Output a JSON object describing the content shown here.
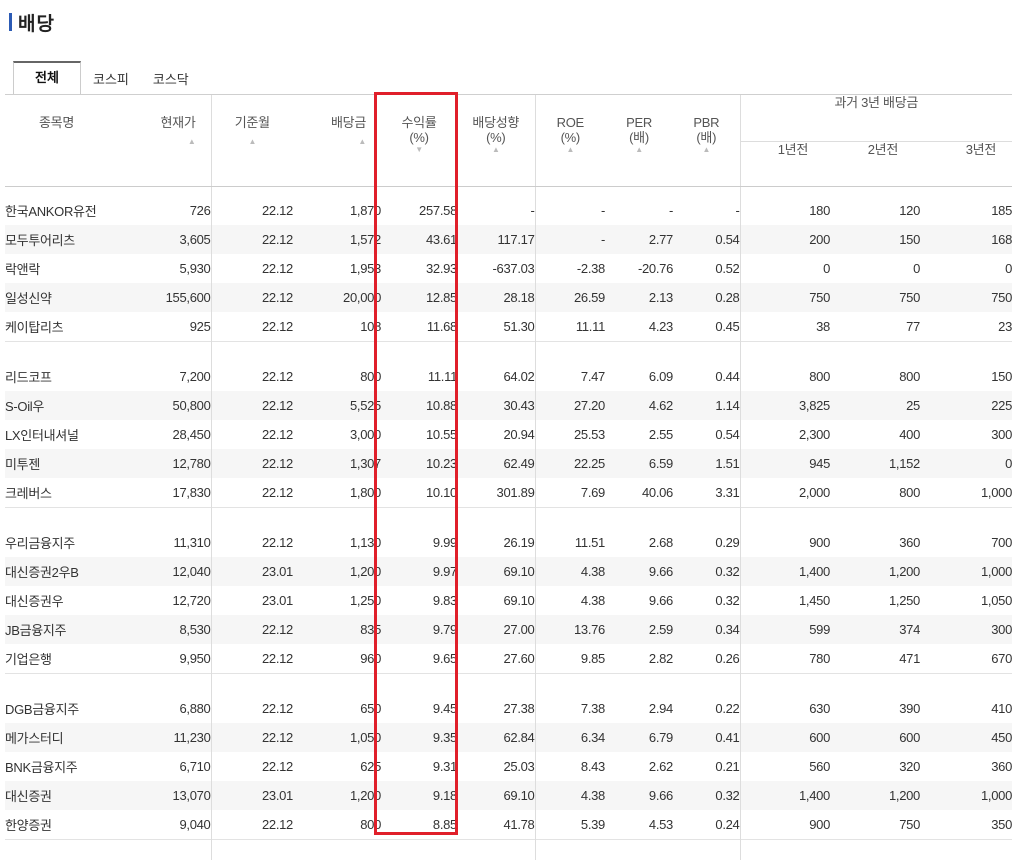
{
  "page_title": "배당",
  "tabs": [
    {
      "label": "전체",
      "active": true
    },
    {
      "label": "코스피",
      "active": false
    },
    {
      "label": "코스닥",
      "active": false
    }
  ],
  "columns": {
    "name": "종목명",
    "price": "현재가",
    "base_month": "기준월",
    "dividend": "배당금",
    "yield_line1": "수익률",
    "yield_line2": "(%)",
    "payout_line1": "배당성향",
    "payout_line2": "(%)",
    "roe_line1": "ROE",
    "roe_line2": "(%)",
    "per_line1": "PER",
    "per_line2": "(배)",
    "pbr_line1": "PBR",
    "pbr_line2": "(배)",
    "past_group": "과거 3년 배당금",
    "y1": "1년전",
    "y2": "2년전",
    "y3": "3년전"
  },
  "sort_icon": "triangle-down-icon",
  "accent_color": "#e01f2a",
  "groups": [
    [
      [
        "한국ANKOR유전",
        "726",
        "22.12",
        "1,870",
        "257.58",
        "-",
        "-",
        "-",
        "-",
        "180",
        "120",
        "185"
      ],
      [
        "모두투어리츠",
        "3,605",
        "22.12",
        "1,572",
        "43.61",
        "117.17",
        "-",
        "2.77",
        "0.54",
        "200",
        "150",
        "168"
      ],
      [
        "락앤락",
        "5,930",
        "22.12",
        "1,953",
        "32.93",
        "-637.03",
        "-2.38",
        "-20.76",
        "0.52",
        "0",
        "0",
        "0"
      ],
      [
        "일성신약",
        "155,600",
        "22.12",
        "20,000",
        "12.85",
        "28.18",
        "26.59",
        "2.13",
        "0.28",
        "750",
        "750",
        "750"
      ],
      [
        "케이탑리츠",
        "925",
        "22.12",
        "108",
        "11.68",
        "51.30",
        "11.11",
        "4.23",
        "0.45",
        "38",
        "77",
        "23"
      ]
    ],
    [
      [
        "리드코프",
        "7,200",
        "22.12",
        "800",
        "11.11",
        "64.02",
        "7.47",
        "6.09",
        "0.44",
        "800",
        "800",
        "150"
      ],
      [
        "S-Oil우",
        "50,800",
        "22.12",
        "5,525",
        "10.88",
        "30.43",
        "27.20",
        "4.62",
        "1.14",
        "3,825",
        "25",
        "225"
      ],
      [
        "LX인터내셔널",
        "28,450",
        "22.12",
        "3,000",
        "10.55",
        "20.94",
        "25.53",
        "2.55",
        "0.54",
        "2,300",
        "400",
        "300"
      ],
      [
        "미투젠",
        "12,780",
        "22.12",
        "1,307",
        "10.23",
        "62.49",
        "22.25",
        "6.59",
        "1.51",
        "945",
        "1,152",
        "0"
      ],
      [
        "크레버스",
        "17,830",
        "22.12",
        "1,800",
        "10.10",
        "301.89",
        "7.69",
        "40.06",
        "3.31",
        "2,000",
        "800",
        "1,000"
      ]
    ],
    [
      [
        "우리금융지주",
        "11,310",
        "22.12",
        "1,130",
        "9.99",
        "26.19",
        "11.51",
        "2.68",
        "0.29",
        "900",
        "360",
        "700"
      ],
      [
        "대신증권2우B",
        "12,040",
        "23.01",
        "1,200",
        "9.97",
        "69.10",
        "4.38",
        "9.66",
        "0.32",
        "1,400",
        "1,200",
        "1,000"
      ],
      [
        "대신증권우",
        "12,720",
        "23.01",
        "1,250",
        "9.83",
        "69.10",
        "4.38",
        "9.66",
        "0.32",
        "1,450",
        "1,250",
        "1,050"
      ],
      [
        "JB금융지주",
        "8,530",
        "22.12",
        "835",
        "9.79",
        "27.00",
        "13.76",
        "2.59",
        "0.34",
        "599",
        "374",
        "300"
      ],
      [
        "기업은행",
        "9,950",
        "22.12",
        "960",
        "9.65",
        "27.60",
        "9.85",
        "2.82",
        "0.26",
        "780",
        "471",
        "670"
      ]
    ],
    [
      [
        "DGB금융지주",
        "6,880",
        "22.12",
        "650",
        "9.45",
        "27.38",
        "7.38",
        "2.94",
        "0.22",
        "630",
        "390",
        "410"
      ],
      [
        "메가스터디",
        "11,230",
        "22.12",
        "1,050",
        "9.35",
        "62.84",
        "6.34",
        "6.79",
        "0.41",
        "600",
        "600",
        "450"
      ],
      [
        "BNK금융지주",
        "6,710",
        "22.12",
        "625",
        "9.31",
        "25.03",
        "8.43",
        "2.62",
        "0.21",
        "560",
        "320",
        "360"
      ],
      [
        "대신증권",
        "13,070",
        "23.01",
        "1,200",
        "9.18",
        "69.10",
        "4.38",
        "9.66",
        "0.32",
        "1,400",
        "1,200",
        "1,000"
      ],
      [
        "한양증권",
        "9,040",
        "22.12",
        "800",
        "8.85",
        "41.78",
        "5.39",
        "4.53",
        "0.24",
        "900",
        "750",
        "350"
      ]
    ]
  ]
}
